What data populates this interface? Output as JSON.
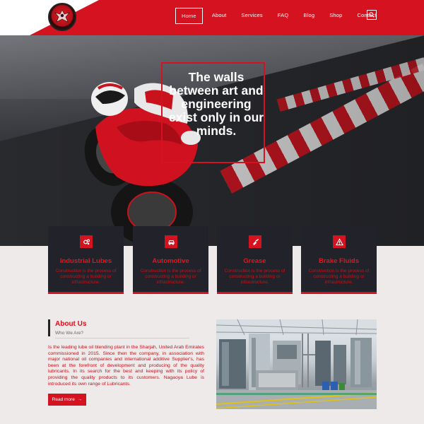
{
  "nav": {
    "items": [
      "Home",
      "About",
      "Services",
      "FAQ",
      "Blog",
      "Shop",
      "Contact"
    ],
    "active": "Home"
  },
  "hero": {
    "headline": "The walls between art and engineering exist only in our minds."
  },
  "cards": [
    {
      "title": "Industrial Lubes",
      "text": "Construction is the process of constructing a building or infrastructure.",
      "icon": "gears-icon"
    },
    {
      "title": "Automotive",
      "text": "Construction is the process of constructing a building or infrastructure.",
      "icon": "car-icon"
    },
    {
      "title": "Grease",
      "text": "Construction is the process of constructing a building or infrastructure.",
      "icon": "grease-gun-icon"
    },
    {
      "title": "Brake Fluids",
      "text": "Construction is the process of constructing a building or infrastructure.",
      "icon": "warning-triangle-icon"
    }
  ],
  "about": {
    "title": "About Us",
    "subtitle": "Who We Are?",
    "body": "Is the leading lube oil blending plant in the Sharjah, United Arab Emirates commissioned in 2015. Since then the company, in association with major national oil companies and international additive Supplier's, has been at the forefront of development and producing of the quality lubricants. In its search for the best and keeping with its policy of providing the quality products to its customers. Nagaoya Lube is introduced its own range of Lubricants.",
    "button": "Read more",
    "button_arrow": "→"
  },
  "colors": {
    "brand_red": "#d5121f",
    "card_bg": "#22232a",
    "page_bg": "#efeaea"
  }
}
